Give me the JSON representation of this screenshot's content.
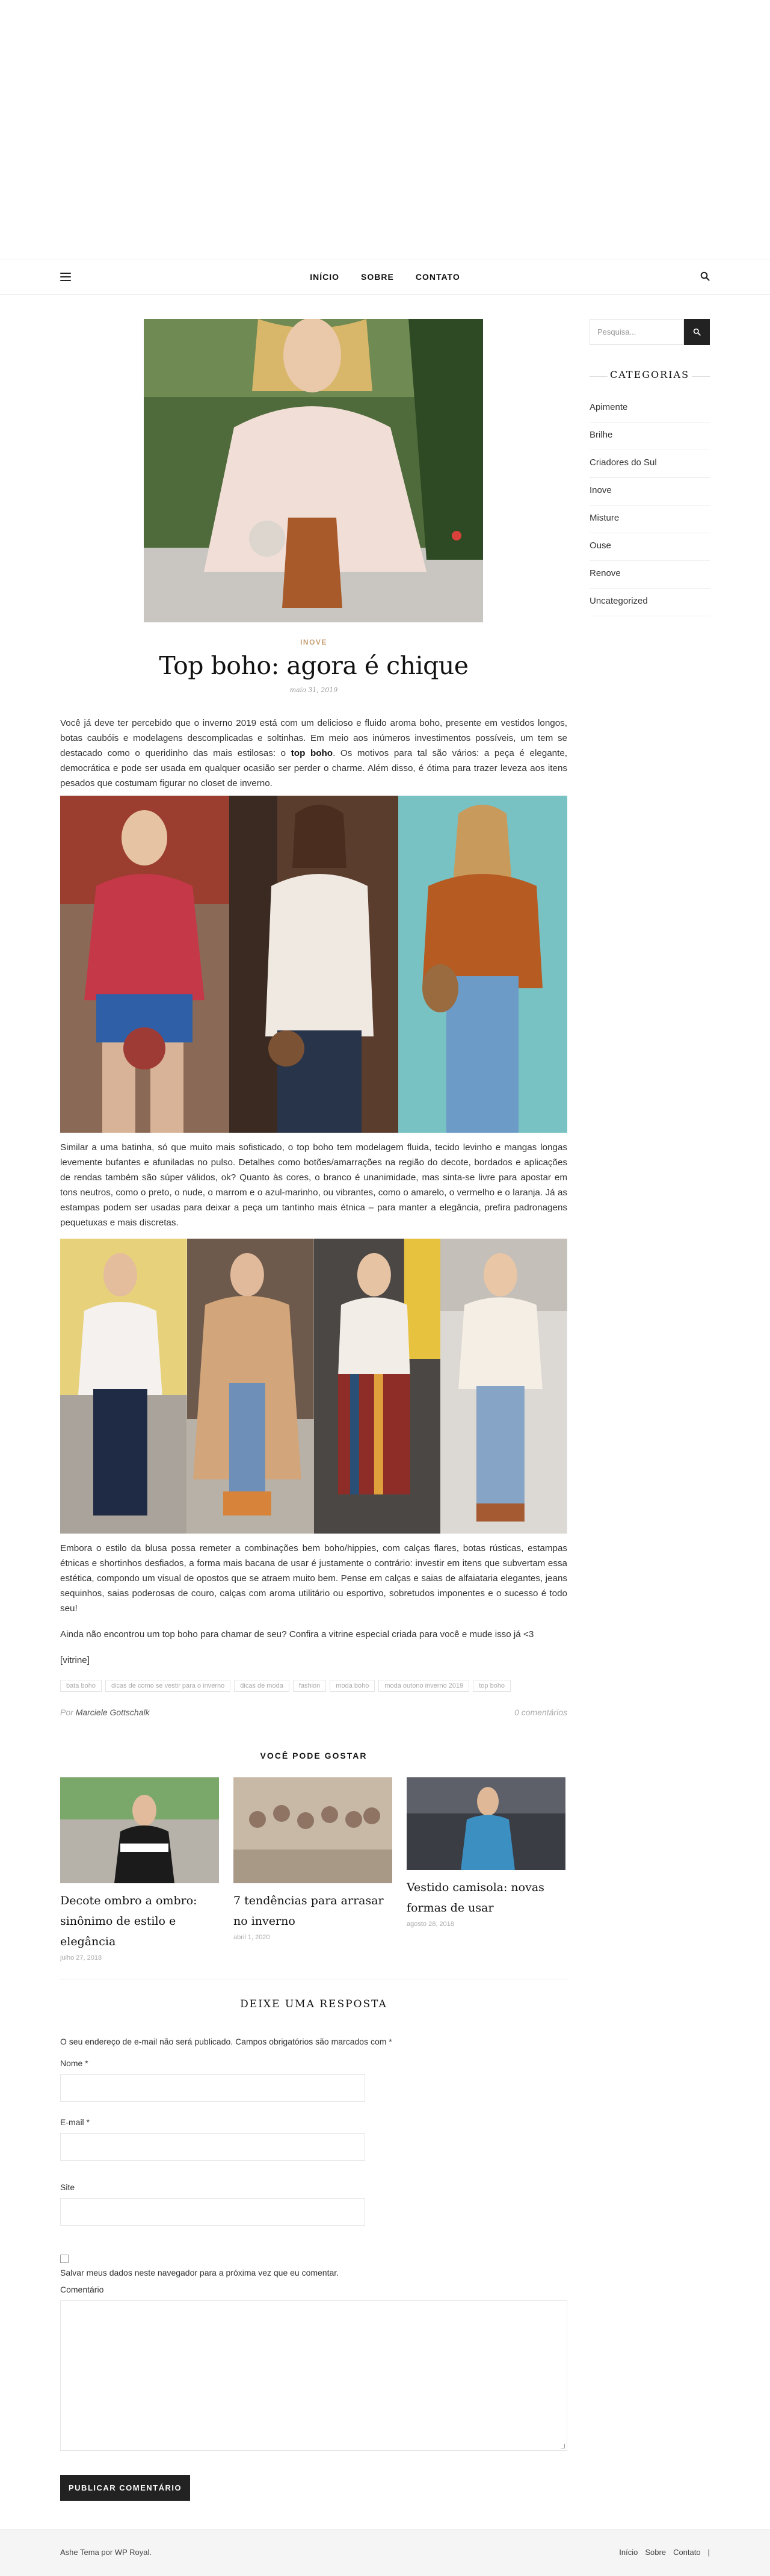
{
  "nav": {
    "items": [
      "INÍCIO",
      "SOBRE",
      "CONTATO"
    ]
  },
  "post": {
    "category": "INOVE",
    "title": "Top boho: agora é chique",
    "date": "maio 31, 2019",
    "p1_before": "Você já deve ter percebido que o inverno 2019 está com um delicioso e fluido aroma boho, presente em vestidos longos, botas caubóis e modelagens descomplicadas e soltinhas. Em meio aos inúmeros investimentos possíveis, um tem se destacado como o queridinho das mais estilosas: o ",
    "p1_bold": "top boho",
    "p1_after": ". Os motivos para tal são vários: a peça é elegante, democrática e pode ser usada em qualquer ocasião ser perder o charme. Além disso, é ótima para trazer leveza aos itens pesados que costumam figurar no closet de inverno.",
    "p2": "Similar a uma batinha, só que muito mais sofisticado, o top boho tem modelagem fluida, tecido levinho e mangas longas levemente bufantes e afuniladas no pulso. Detalhes como botões/amarrações na região do decote, bordados e aplicações de rendas também são súper válidos, ok? Quanto às cores, o branco é unanimidade, mas sinta-se livre para apostar em tons neutros, como o preto, o nude, o marrom e o azul-marinho, ou vibrantes, como o amarelo, o vermelho e o laranja. Já as estampas podem ser usadas para deixar a peça um tantinho mais étnica – para manter a elegância, prefira padronagens pequetuxas e mais discretas.",
    "p3": "Embora o estilo da blusa possa remeter a combinações bem boho/hippies, com calças flares, botas rústicas, estampas étnicas e shortinhos desfiados, a forma mais bacana de usar é justamente o contrário: investir em itens que subvertam essa estética, compondo um visual de opostos que se atraem muito bem. Pense em calças e saias de alfaiataria elegantes, jeans sequinhos, saias poderosas de couro, calças com aroma utilitário ou esportivo, sobretudos imponentes e o sucesso é todo seu!",
    "p4": "Ainda não encontrou um top boho para chamar de seu? Confira a vitrine especial criada para você e mude isso já <3",
    "p5": "[vitrine]",
    "tags": [
      "bata boho",
      "dicas de como se vestir para o inverno",
      "dicas de moda",
      "fashion",
      "moda boho",
      "moda outono inverno 2019",
      "top boho"
    ],
    "by": "Por",
    "author": "Marciele Gottschalk",
    "comments": "0 comentários"
  },
  "related": {
    "heading": "VOCÊ PODE GOSTAR",
    "items": [
      {
        "title": "Decote ombro a ombro: sinônimo de estilo e elegância",
        "date": "julho 27, 2018"
      },
      {
        "title": "7 tendências para arrasar no inverno",
        "date": "abril 1, 2020"
      },
      {
        "title": "Vestido camisola: novas formas de usar",
        "date": "agosto 28, 2018"
      }
    ]
  },
  "reply": {
    "heading": "DEIXE UMA RESPOSTA",
    "notice": "O seu endereço de e-mail não será publicado. Campos obrigatórios são marcados com *",
    "name_label": "Nome *",
    "email_label": "E-mail *",
    "site_label": "Site",
    "save_label": "Salvar meus dados neste navegador para a próxima vez que eu comentar.",
    "comment_label": "Comentário",
    "submit": "PUBLICAR COMENTÁRIO"
  },
  "sidebar": {
    "search_placeholder": "Pesquisa...",
    "categories_title": "CATEGORIAS",
    "categories": [
      "Apimente",
      "Brilhe",
      "Criadores do Sul",
      "Inove",
      "Misture",
      "Ouse",
      "Renove",
      "Uncategorized"
    ]
  },
  "footer": {
    "copyright": "Ashe Tema por WP Royal.",
    "links": [
      "Início",
      "Sobre",
      "Contato"
    ]
  },
  "colors": {
    "accent": "#c69f73",
    "dark": "#222222"
  }
}
